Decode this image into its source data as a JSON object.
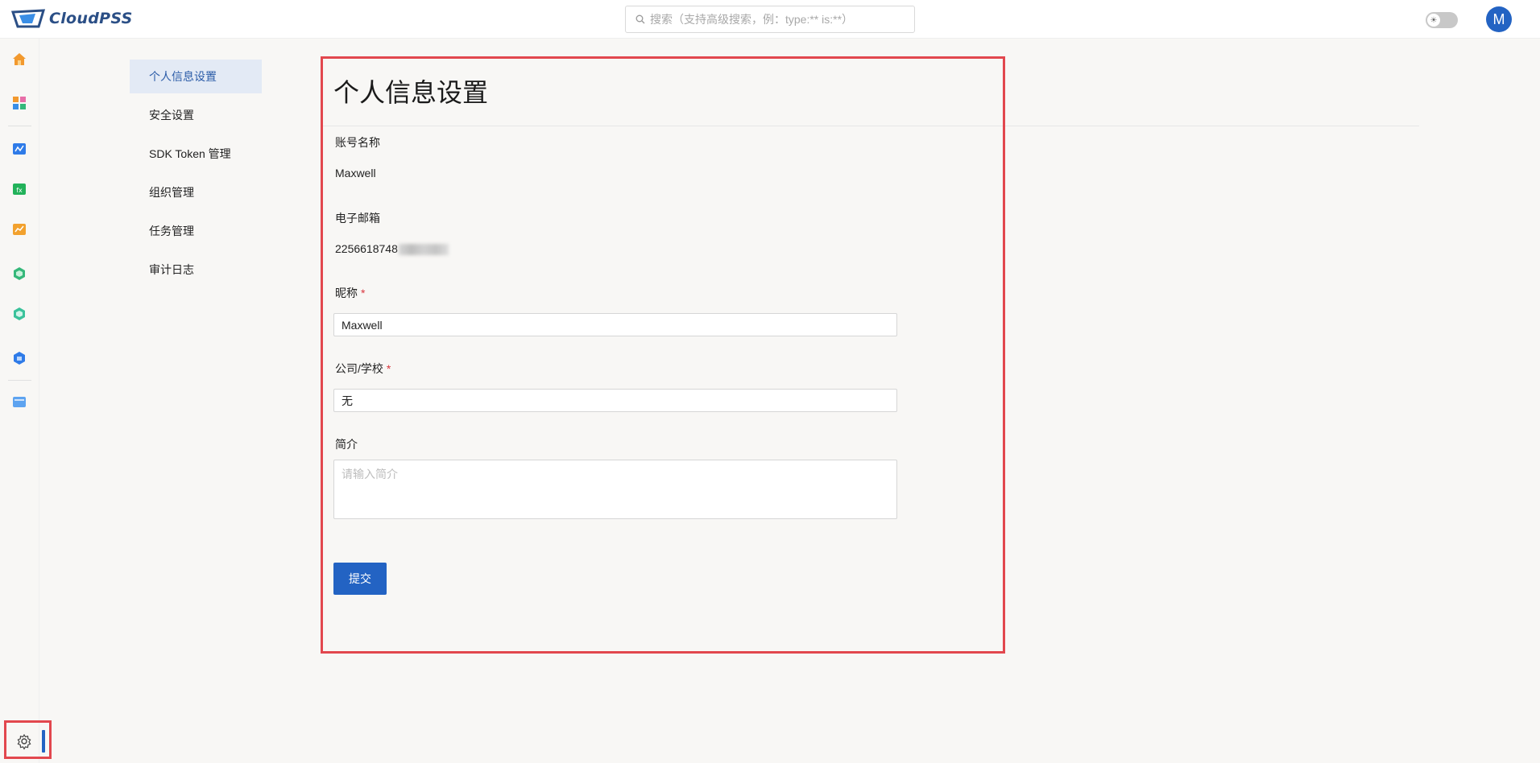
{
  "header": {
    "logo_text": "CloudPSS",
    "search_placeholder": "搜索（支持高级搜索，例：type:** is:**）",
    "avatar_letter": "M",
    "theme_toggle_icon": "sun-icon"
  },
  "rail": {
    "items": [
      {
        "name": "home-icon"
      },
      {
        "name": "apps-icon"
      },
      {
        "name": "emtlab-icon"
      },
      {
        "name": "function-icon"
      },
      {
        "name": "chart-icon"
      },
      {
        "name": "model-icon"
      },
      {
        "name": "model-alt-icon"
      },
      {
        "name": "sdk-icon"
      },
      {
        "name": "folder-icon"
      }
    ],
    "settings_icon": "gear-icon"
  },
  "subnav": {
    "items": [
      {
        "label": "个人信息设置",
        "active": true
      },
      {
        "label": "安全设置"
      },
      {
        "label": "SDK Token 管理"
      },
      {
        "label": "组织管理"
      },
      {
        "label": "任务管理"
      },
      {
        "label": "审计日志"
      }
    ]
  },
  "form": {
    "title": "个人信息设置",
    "account_label": "账号名称",
    "account_value": "Maxwell",
    "email_label": "电子邮箱",
    "email_value": "2256618748",
    "nickname_label": "昵称",
    "nickname_value": "Maxwell",
    "company_label": "公司/学校",
    "company_value": "无",
    "bio_label": "简介",
    "bio_placeholder": "请输入简介",
    "required_mark": "*",
    "submit_label": "提交"
  },
  "colors": {
    "primary": "#2363c3",
    "highlight_border": "#e2474e",
    "active_nav_bg": "#e3eaf5"
  }
}
